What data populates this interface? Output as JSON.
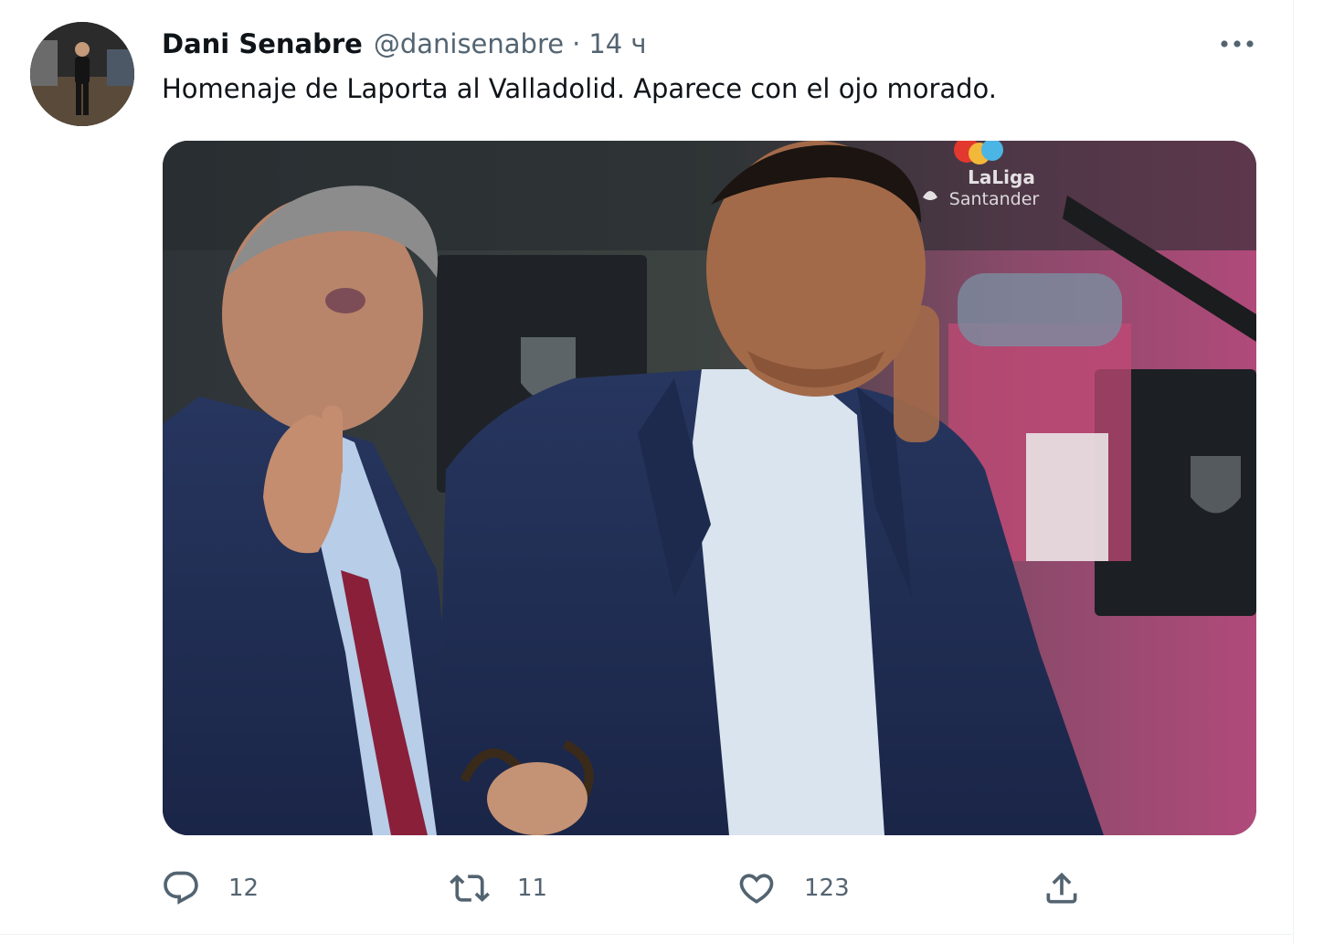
{
  "tweet": {
    "author": {
      "display_name": "Dani Senabre",
      "handle": "@danisenabre",
      "separator": "·",
      "timestamp": "14 ч"
    },
    "text": "Homenaje de Laporta al Valladolid. Aparece con el ojo morado.",
    "media": {
      "overlay_logo_lines": [
        "LaLiga",
        "Santander"
      ]
    },
    "actions": {
      "reply_count": "12",
      "retweet_count": "11",
      "like_count": "123"
    }
  },
  "icons": {
    "more": "more-horizontal-icon",
    "reply": "reply-icon",
    "retweet": "retweet-icon",
    "like": "heart-icon",
    "share": "share-icon"
  },
  "colors": {
    "text_primary": "#0f1419",
    "text_secondary": "#536471",
    "divider": "#eff3f4"
  }
}
